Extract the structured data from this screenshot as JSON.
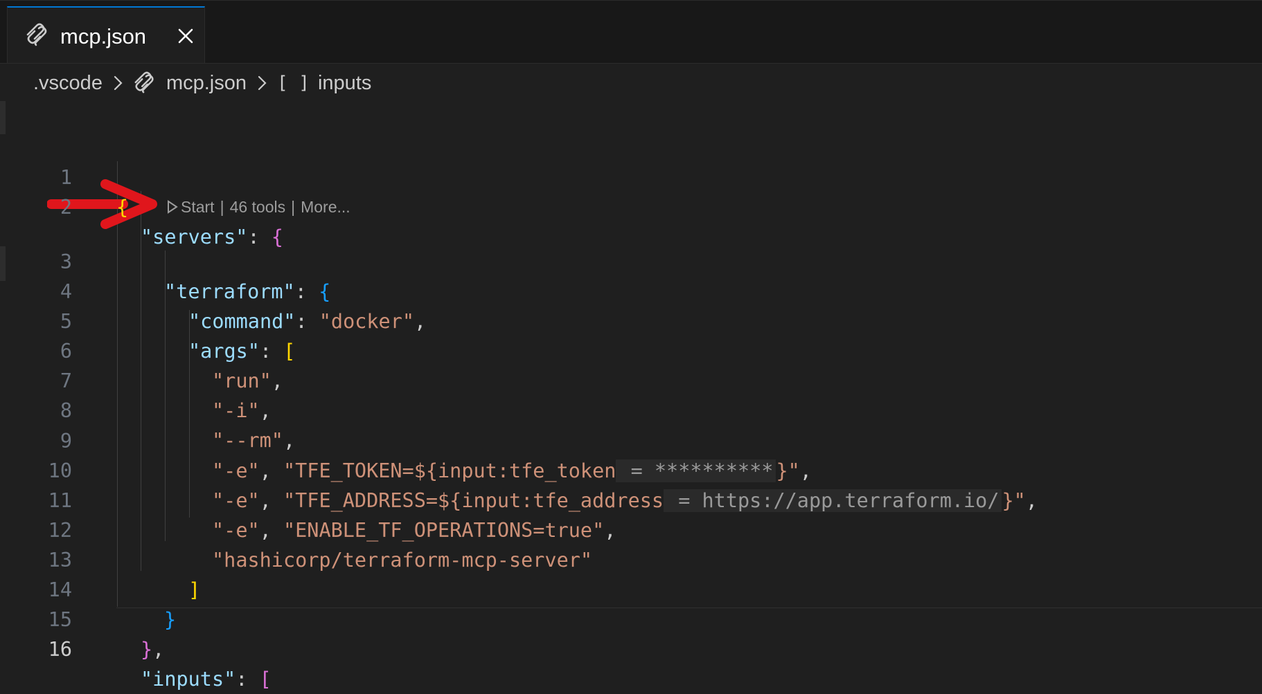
{
  "tab": {
    "icon": "mcp-icon",
    "label": "mcp.json",
    "close_icon": "close-icon"
  },
  "breadcrumb": {
    "folder": ".vscode",
    "file_icon": "mcp-icon",
    "file": "mcp.json",
    "symbol_icon": "[ ]",
    "symbol": "inputs"
  },
  "codelens": {
    "start_label": "Start",
    "tools_label": "46 tools",
    "more_label": "More...",
    "separator": "|"
  },
  "annotation": {
    "arrow_icon": "red-arrow-icon",
    "color": "#e0161c"
  },
  "editor": {
    "lines": [
      {
        "number": "1"
      },
      {
        "number": "2"
      },
      {
        "number": "3"
      },
      {
        "number": "4"
      },
      {
        "number": "5"
      },
      {
        "number": "6"
      },
      {
        "number": "7"
      },
      {
        "number": "8"
      },
      {
        "number": "9"
      },
      {
        "number": "10"
      },
      {
        "number": "11"
      },
      {
        "number": "12"
      },
      {
        "number": "13"
      },
      {
        "number": "14"
      },
      {
        "number": "15"
      },
      {
        "number": "16"
      }
    ],
    "tokens": {
      "open_brace": "{",
      "close_brace": "}",
      "open_bracket": "[",
      "close_bracket": "]",
      "colon": ": ",
      "comma": ",",
      "servers_key": "\"servers\"",
      "terraform_key": "\"terraform\"",
      "command_key": "\"command\"",
      "command_value": "\"docker\"",
      "args_key": "\"args\"",
      "arg_run": "\"run\"",
      "arg_i": "\"-i\"",
      "arg_rm": "\"--rm\"",
      "arg_e": "\"-e\"",
      "token_str_start": "\"TFE_TOKEN=${input:tfe_token",
      "token_hint": " = **********",
      "token_str_end": "}\"",
      "address_str_start": "\"TFE_ADDRESS=${input:tfe_address",
      "address_hint": " = https://app.terraform.io/",
      "address_str_end": "}\"",
      "ops_str": "\"ENABLE_TF_OPERATIONS=true\"",
      "image_str": "\"hashicorp/terraform-mcp-server\"",
      "inputs_key": "\"inputs\"",
      "comma_space": ", "
    }
  },
  "colors": {
    "background": "#1f1f1f",
    "tab_active_border": "#0078d4",
    "key": "#9cdcfe",
    "string": "#ce9178",
    "bracket_level1": "#ffd700",
    "bracket_level2": "#da70d6",
    "bracket_level3": "#179fff"
  }
}
